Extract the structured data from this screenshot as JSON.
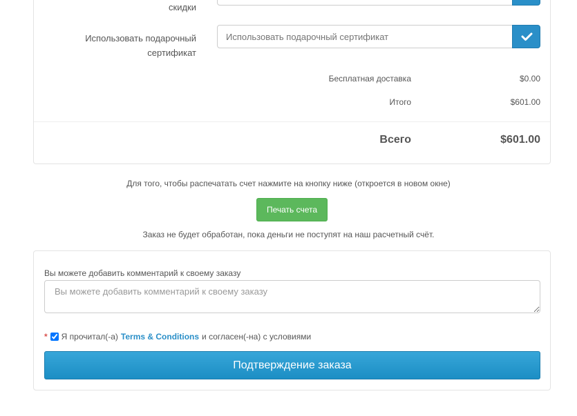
{
  "discount_row": {
    "label": "скидки"
  },
  "gift_certificate": {
    "label_line1": "Использовать подарочный",
    "label_line2": "сертификат",
    "placeholder": "Использовать подарочный сертификат",
    "apply_icon": "check-icon"
  },
  "totals": {
    "shipping_label": "Бесплатная доставка",
    "shipping_value": "$0.00",
    "subtotal_label": "Итого",
    "subtotal_value": "$601.00",
    "grand_label": "Всего",
    "grand_value": "$601.00"
  },
  "print_invoice": {
    "instruction": "Для того, чтобы распечатать счет нажмите на кнопку ниже (откроется в новом окне)",
    "button_label": "Печать счета",
    "notice": "Заказ не будет обработан, пока деньги не поступят на наш расчетный счёт."
  },
  "comment": {
    "label": "Вы можете добавить комментарий к своему заказу",
    "placeholder": "Вы можете добавить комментарий к своему заказу"
  },
  "agreement": {
    "required_mark": "*",
    "text_before": "Я прочитал(-а)",
    "link_text": "Terms & Conditions",
    "text_after": "и согласен(-на) с условиями",
    "checked": true
  },
  "confirm_button_label": "Подтверждение заказа",
  "colors": {
    "primary_blue": "#2a8fc8",
    "success_green": "#5cb85c",
    "link_blue": "#2a8fc8",
    "required_red": "#d9534f"
  }
}
